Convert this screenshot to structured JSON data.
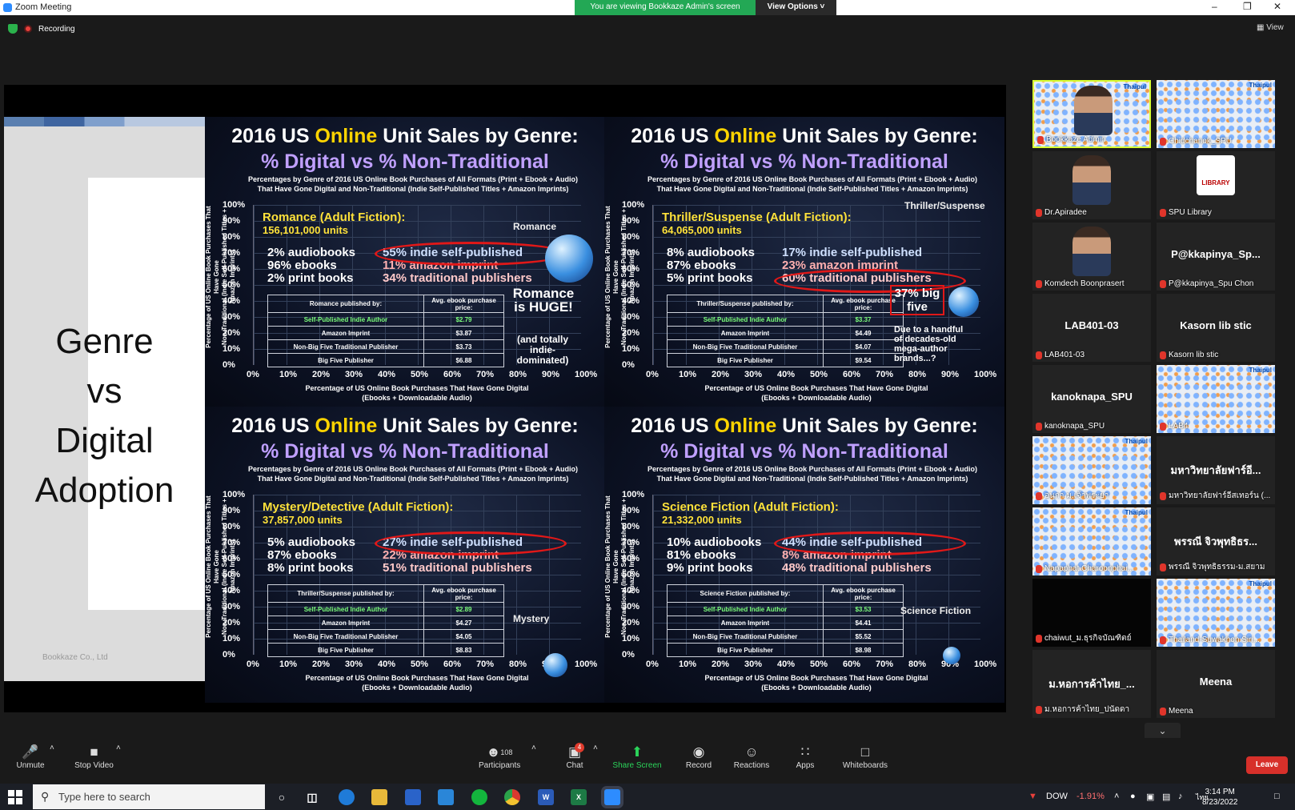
{
  "window": {
    "title": "Zoom Meeting",
    "viewing_banner": "You are viewing Bookkaze Admin's screen",
    "view_options": "View Options ˅"
  },
  "status": {
    "recording": "Recording",
    "view": "View"
  },
  "slide": {
    "title_lines": [
      "Genre",
      "vs",
      "Digital",
      "Adoption"
    ],
    "footer": "Bookkaze Co., Ltd",
    "quadrants": [
      {
        "title1_pre": "2016 US ",
        "title1_hl": "Online",
        "title1_post": " Unit Sales by Genre:",
        "title2": "% Digital vs % Non-Traditional",
        "subtitle1": "Percentages by Genre of 2016 US Online Book Purchases of All Formats (Print + Ebook + Audio)",
        "subtitle2": "That Have Gone Digital and Non-Traditional (Indie Self-Published Titles + Amazon Imprints)",
        "genre": "Romance (Adult Fiction):",
        "units": "156,101,000 units",
        "formats": [
          "2% audiobooks",
          "96% ebooks",
          "2% print books"
        ],
        "publishers": [
          "55% indie self-published",
          "11% amazon imprint",
          "34% traditional publishers"
        ],
        "table_header": [
          "Romance published by:",
          "Avg. ebook purchase price:"
        ],
        "rows": [
          [
            "Self-Published Indie Author",
            "$2.79"
          ],
          [
            "Amazon Imprint",
            "$3.87"
          ],
          [
            "Non-Big Five Traditional Publisher",
            "$3.73"
          ],
          [
            "Big Five Publisher",
            "$6.88"
          ]
        ],
        "label": "Romance",
        "note1": "Romance is HUGE!",
        "note2": "(and totally indie-dominated)"
      },
      {
        "title1_pre": "2016 US ",
        "title1_hl": "Online",
        "title1_post": " Unit Sales by Genre:",
        "title2": "% Digital vs % Non-Traditional",
        "subtitle1": "Percentages by Genre of 2016 US Online Book Purchases of All Formats (Print + Ebook + Audio)",
        "subtitle2": "That Have Gone Digital and Non-Traditional (Indie Self-Published Titles + Amazon Imprints)",
        "genre": "Thriller/Suspense (Adult Fiction):",
        "units": "64,065,000 units",
        "formats": [
          "8% audiobooks",
          "87% ebooks",
          "5% print books"
        ],
        "publishers": [
          "17% indie self-published",
          "23% amazon imprint",
          "60% traditional publishers"
        ],
        "table_header": [
          "Thriller/Suspense published by:",
          "Avg. ebook purchase price:"
        ],
        "rows": [
          [
            "Self-Published Indie Author",
            "$3.37"
          ],
          [
            "Amazon Imprint",
            "$4.49"
          ],
          [
            "Non-Big Five Traditional Publisher",
            "$4.07"
          ],
          [
            "Big Five Publisher",
            "$9.54"
          ]
        ],
        "label": "Thriller/Suspense",
        "note1": "37% big five",
        "note2": "Due to a handful of decades-old mega-author brands...?"
      },
      {
        "title1_pre": "2016 US ",
        "title1_hl": "Online",
        "title1_post": " Unit Sales by Genre:",
        "title2": "% Digital vs % Non-Traditional",
        "subtitle1": "Percentages by Genre of 2016 US Online Book Purchases of All Formats (Print + Ebook + Audio)",
        "subtitle2": "That Have Gone Digital and Non-Traditional (Indie Self-Published Titles + Amazon Imprints)",
        "genre": "Mystery/Detective (Adult Fiction):",
        "units": "37,857,000 units",
        "formats": [
          "5% audiobooks",
          "87% ebooks",
          "8% print books"
        ],
        "publishers": [
          "27% indie self-published",
          "22% amazon imprint",
          "51% traditional publishers"
        ],
        "table_header": [
          "Thriller/Suspense published by:",
          "Avg. ebook purchase price:"
        ],
        "rows": [
          [
            "Self-Published Indie Author",
            "$2.89"
          ],
          [
            "Amazon Imprint",
            "$4.27"
          ],
          [
            "Non-Big Five Traditional Publisher",
            "$4.05"
          ],
          [
            "Big Five Publisher",
            "$8.83"
          ]
        ],
        "label": "Mystery",
        "note1": "",
        "note2": ""
      },
      {
        "title1_pre": "2016 US ",
        "title1_hl": "Online",
        "title1_post": " Unit Sales by Genre:",
        "title2": "% Digital vs % Non-Traditional",
        "subtitle1": "Percentages by Genre of 2016 US Online Book Purchases of All Formats (Print + Ebook + Audio)",
        "subtitle2": "That Have Gone Digital and Non-Traditional (Indie Self-Published Titles + Amazon Imprints)",
        "genre": "Science Fiction (Adult Fiction):",
        "units": "21,332,000 units",
        "formats": [
          "10% audiobooks",
          "81% ebooks",
          "9% print books"
        ],
        "publishers": [
          "44% indie self-published",
          "8% amazon imprint",
          "48% traditional publishers"
        ],
        "table_header": [
          "Science Fiction published by:",
          "Avg. ebook purchase price:"
        ],
        "rows": [
          [
            "Self-Published Indie Author",
            "$3.53"
          ],
          [
            "Amazon Imprint",
            "$4.41"
          ],
          [
            "Non-Big Five Traditional Publisher",
            "$5.52"
          ],
          [
            "Big Five Publisher",
            "$8.98"
          ]
        ],
        "label": "Science Fiction",
        "note1": "",
        "note2": ""
      }
    ],
    "y_ticks": [
      "100%",
      "90%",
      "80%",
      "70%",
      "60%",
      "50%",
      "40%",
      "30%",
      "20%",
      "10%",
      "0%"
    ],
    "x_ticks": [
      "0%",
      "10%",
      "20%",
      "30%",
      "40%",
      "50%",
      "60%",
      "70%",
      "80%",
      "90%",
      "100%"
    ],
    "x_title1": "Percentage of US Online Book Purchases That Have Gone Digital",
    "x_title2": "(Ebooks + Downloadable Audio)",
    "y_title1": "Percentage of US Online Book Purchases That Have Gone",
    "y_title2": "Non-Traditional (Indie Self-Published Titles + Amazon Imprints)"
  },
  "participants": [
    {
      "name": "Bookkaze Admin",
      "big": "",
      "kind": "video-pattern",
      "active": true
    },
    {
      "name": "Chidchanok_SPU",
      "big": "",
      "kind": "pattern",
      "active": false
    },
    {
      "name": "Dr.Apiradee",
      "big": "",
      "kind": "photo",
      "active": false
    },
    {
      "name": "SPU Library",
      "big": "",
      "kind": "library",
      "active": false
    },
    {
      "name": "Komdech Boonprasert",
      "big": "",
      "kind": "photo",
      "active": false
    },
    {
      "name": "P@kkapinya_Spu Chon",
      "big": "P@kkapinya_Sp...",
      "kind": "name",
      "active": false
    },
    {
      "name": "LAB401-03",
      "big": "LAB401-03",
      "kind": "name",
      "active": false
    },
    {
      "name": "Kasorn lib stic",
      "big": "Kasorn lib stic",
      "kind": "name",
      "active": false
    },
    {
      "name": "kanoknapa_SPU",
      "big": "kanoknapa_SPU",
      "kind": "name",
      "active": false
    },
    {
      "name": "LAB4",
      "big": "",
      "kind": "pattern",
      "active": false
    },
    {
      "name": "อนุกา ม.เจ้าพระยา",
      "big": "",
      "kind": "pattern",
      "active": false
    },
    {
      "name": "มหาวิทยาลัยฟาร์อีสเทอร์น (...",
      "big": "มหาวิทยาลัยฟาร์อี...",
      "kind": "name",
      "active": false
    },
    {
      "name": "Napaphat Charoonphai...",
      "big": "",
      "kind": "pattern",
      "active": false
    },
    {
      "name": "พรรณี จิวพุทธิธรรม-ม.สยาม",
      "big": "พรรณี จิวพุทธิธร...",
      "kind": "name",
      "active": false
    },
    {
      "name": "chaiwut_ม.ธุรกิจบัณฑิตย์",
      "big": "",
      "kind": "black",
      "active": false
    },
    {
      "name": "Thailand-Suwakhon Siri...",
      "big": "",
      "kind": "pattern",
      "active": false
    },
    {
      "name": "ม.หอการค้าไทย_ปนัดดา",
      "big": "ม.หอการค้าไทย_...",
      "kind": "name",
      "active": false
    },
    {
      "name": "Meena",
      "big": "Meena",
      "kind": "name",
      "active": false
    }
  ],
  "library_icon_text": "LIBRARY",
  "thaipul": "Thaipul",
  "toolbar": {
    "unmute": "Unmute",
    "stop_video": "Stop Video",
    "participants": "Participants",
    "participant_count": "108",
    "chat": "Chat",
    "chat_badge": "4",
    "share_screen": "Share Screen",
    "record": "Record",
    "reactions": "Reactions",
    "apps": "Apps",
    "whiteboards": "Whiteboards",
    "leave": "Leave"
  },
  "taskbar": {
    "search_placeholder": "Type here to search",
    "stock": "DOW",
    "stock_change": "-1.91%",
    "lang": "ไทย",
    "time": "3:14 PM",
    "date": "8/23/2022"
  },
  "colors": {
    "zoom_blue": "#2d8cff",
    "banner_green": "#23a855",
    "leave_red": "#d7302a",
    "active_tile": "#d9ff32",
    "highlight_yellow": "#ffd400",
    "ellipse_red": "#e01818"
  }
}
